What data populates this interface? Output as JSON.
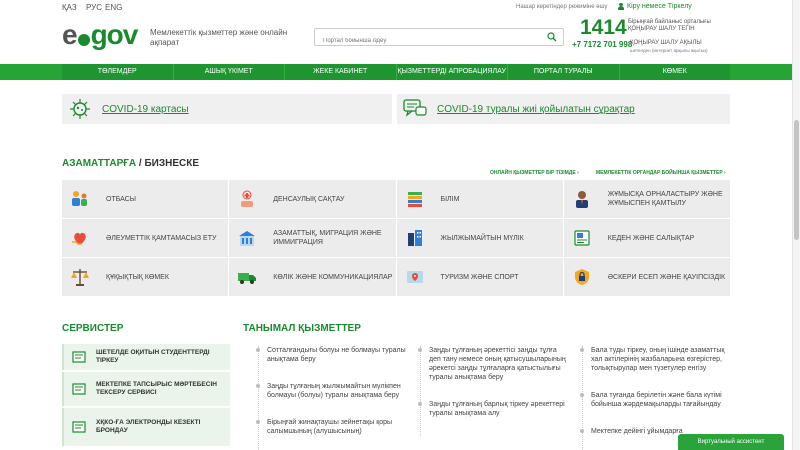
{
  "topbar": {
    "languages": [
      "ҚАЗ",
      "РУС",
      "ENG"
    ],
    "low_vision_label": "Нашар көретіндер режиміне өшу",
    "login_label": "Кіру немесе Тіркелу"
  },
  "header": {
    "logo_text_prefix": "e",
    "logo_text_suffix": "gov",
    "tagline": "Мемлекеттік қызметтер және онлайн ақпарат",
    "search_placeholder": "Портал бойынша іздеу",
    "callcenter_number": "1414",
    "callcenter_text": "Бірыңғай байланыс орталығы ҚОҢЫРАУ ШАЛУ ТЕГІН",
    "phone_number": "+7 7172 701 998",
    "phone_text": "ҚОҢЫРАУ ШАЛУ АҚЫЛЫ",
    "phone_subtext": "шетелден (интернет арқылы ақысыз)"
  },
  "nav": {
    "items": [
      "ТӨЛЕМДЕР",
      "АШЫҚ ҮКІМЕТ",
      "ЖЕКЕ КАБИНЕТ",
      "ҚЫЗМЕТТЕРДІ АПРОБАЦИЯЛАУ",
      "ПОРТАЛ ТУРАЛЫ",
      "КӨМЕК"
    ]
  },
  "covid": {
    "map_label": "COVID-19 картасы",
    "faq_label": "COVID-19 туралы жиі қойылатын сұрақтар"
  },
  "categories": {
    "title_green": "АЗАМАТТАРҒА",
    "title_rest": " / БИЗНЕСКЕ",
    "link_all_services": "ОНЛАЙН ҚЫЗМЕТТЕР БІР ТІЗІМДЕ ›",
    "link_gov_services": "МЕМЛЕКЕТТІК ОРГАНДАР БОЙЫНША ҚЫЗМЕТТЕР ›",
    "items": [
      {
        "label": "Отбасы",
        "icon": "family-icon"
      },
      {
        "label": "Денсаулық сақтау",
        "icon": "healthcare-icon"
      },
      {
        "label": "Білім",
        "icon": "education-icon"
      },
      {
        "label": "Жұмысқа орналастыру және жұмыспен қамтылу",
        "icon": "employment-icon"
      },
      {
        "label": "Әлеуметтік қамтамасыз ету",
        "icon": "social-security-icon"
      },
      {
        "label": "Азаматтық, миграция және иммиграция",
        "icon": "migration-icon"
      },
      {
        "label": "Жылжымайтын мүлік",
        "icon": "real-estate-icon"
      },
      {
        "label": "Кеден және салықтар",
        "icon": "customs-taxes-icon"
      },
      {
        "label": "Құқықтық көмек",
        "icon": "legal-aid-icon"
      },
      {
        "label": "Көлік және коммуникациялар",
        "icon": "transport-icon"
      },
      {
        "label": "Туризм және спорт",
        "icon": "tourism-icon"
      },
      {
        "label": "Әскери есеп және қауіпсіздік",
        "icon": "military-security-icon"
      }
    ]
  },
  "services": {
    "title": "СЕРВИСТЕР",
    "items": [
      "Шетелде оқитын студенттерді тіркеу",
      "Мектепке тапсырыс мәртебесін тексеру сервисі",
      "ХҚКО-ға электронды кезекті брондау"
    ]
  },
  "popular": {
    "title": "ТАНЫМАЛ ҚЫЗМЕТТЕР",
    "columns": [
      [
        "Сотталғандығы болуы не болмауы туралы анықтама беру",
        "Заңды тұлғаның жылжымайтын мүлікпен болмауы (болуы) туралы анықтама беру",
        "Бірыңғай жинақтаушы зейнетақы қоры салымшының (алушысының)"
      ],
      [
        "Заңды тұлғаның әрекеттісі заңды тұлға деп тану немесе оның қатысушыларының әрекетсі заңды тұлғаларға қатыстылығы туралы анықтама беру",
        "Заңды тұлғаның барлық тіркеу әрекеттері туралы анықтама алу"
      ],
      [
        "Бала туды тіркеу, оның ішінде азаматтық хал актілерінің жазбаларына өзгерістер, толықтырулар мен түзетулер енгізу",
        "Бала туғанда берілетін және бала күтімі бойынша жәрдемақыларды тағайындау",
        "Мектепке дейінгі ұйымдарға"
      ]
    ]
  },
  "assistant_label": "Виртуальный ассистент",
  "colors": {
    "brand_green": "#1a8a2e",
    "nav_green": "#1f9531"
  }
}
